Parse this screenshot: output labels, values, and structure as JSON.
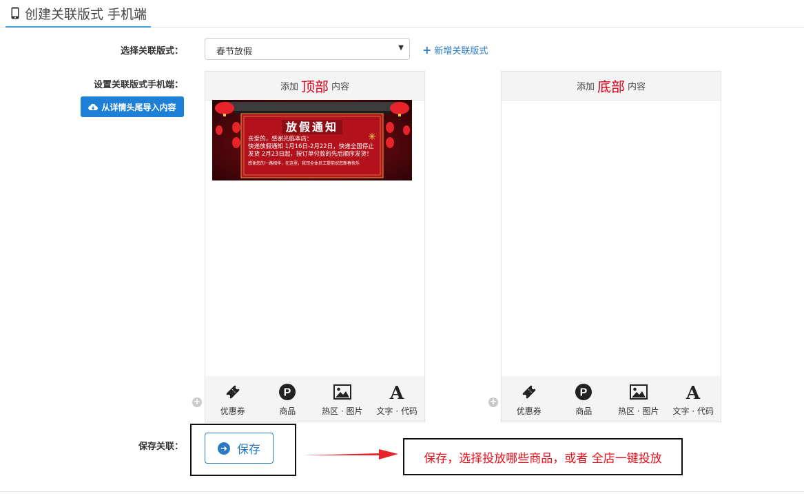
{
  "header": {
    "title": "创建关联版式 手机端",
    "icon": "mobile-phone-icon"
  },
  "form": {
    "select_label": "选择关联版式：",
    "selected_style": "春节放假",
    "add_style_link": "新增关联版式",
    "mobile_label": "设置关联版式手机端：",
    "import_button": "从详情头尾导入内容",
    "save_label": "保存关联："
  },
  "top_panel": {
    "prefix": "添加",
    "highlight": "顶部",
    "suffix": "内容"
  },
  "bottom_panel": {
    "prefix": "添加",
    "highlight": "底部",
    "suffix": "内容"
  },
  "toolbar": [
    {
      "label": "优惠券",
      "icon": "coupon-icon"
    },
    {
      "label": "商品",
      "icon": "product-p-icon"
    },
    {
      "label": "热区 · 图片",
      "icon": "image-icon"
    },
    {
      "label": "文字 · 代码",
      "icon": "text-a-icon"
    }
  ],
  "banner": {
    "heading": "放假通知",
    "lines": [
      "亲爱的，感谢光临本店：",
      "快递放假通知 1月16日-2月22日，快递全国停止",
      "发货 2月23日起，按订单付款的先后顺序发货！",
      "感谢您的一路相伴，在这里，我司全体员工提前祝您新春快乐"
    ]
  },
  "save_button": "保存",
  "annotation": "保存，选择投放哪些商品，或者  全店一键投放",
  "colors": {
    "accent": "#2a7bc4",
    "highlight_red": "#e0001a",
    "import_blue": "#1e7fd6"
  }
}
